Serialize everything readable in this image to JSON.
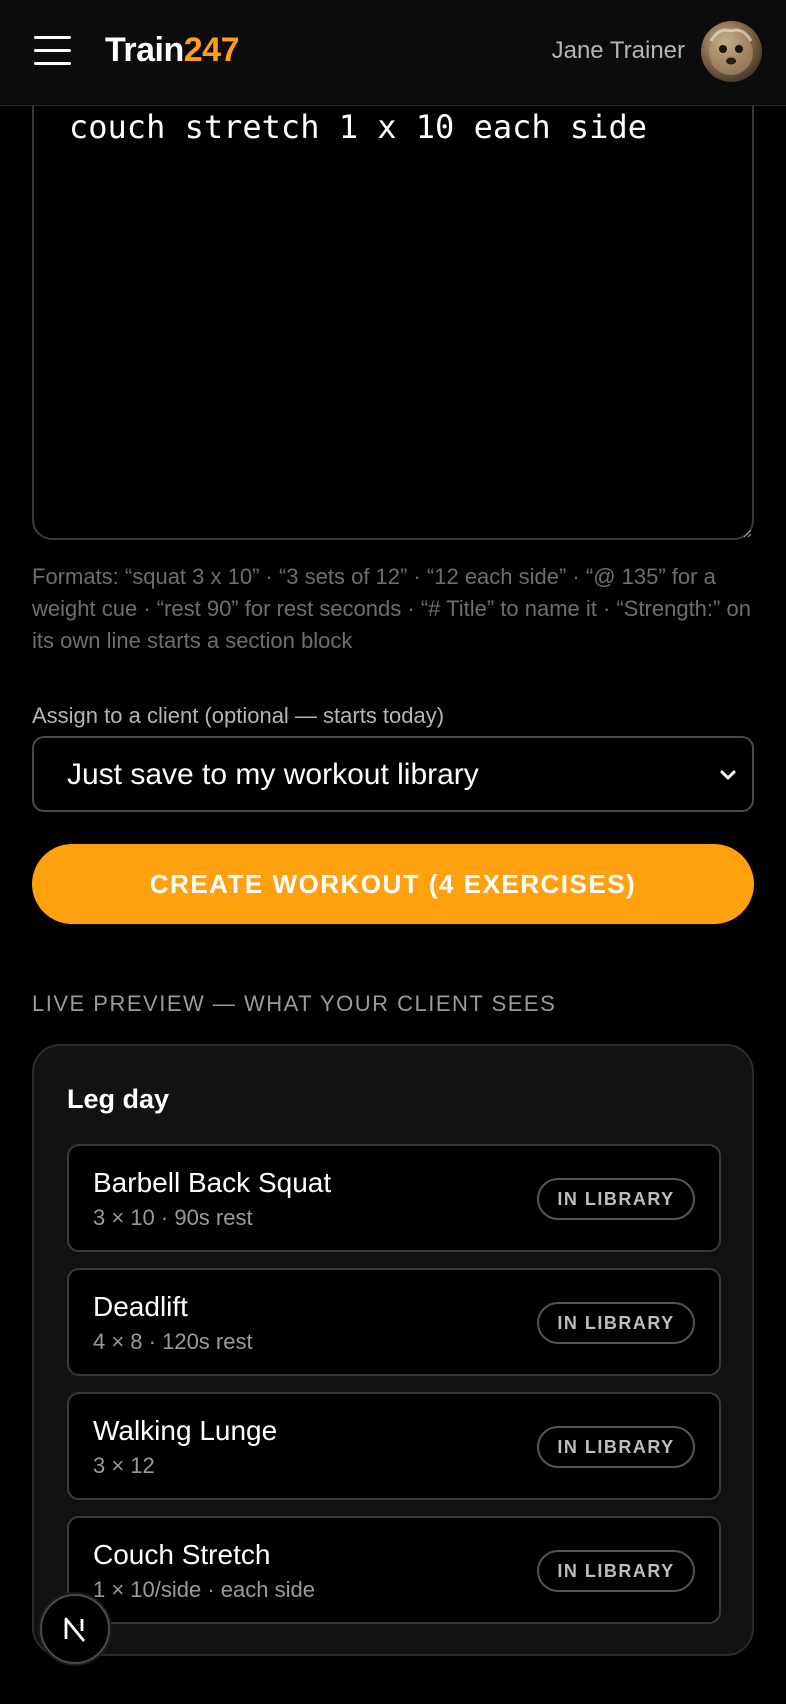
{
  "header": {
    "brand_main": "Train",
    "brand_accent": "247",
    "user_name": "Jane Trainer",
    "accent_color": "#ffa00f"
  },
  "editor": {
    "text": "couch stretch 1 x 10 each side",
    "help": "Formats: “squat 3 x 10” · “3 sets of 12” · “12 each side” · “@ 135” for a weight cue · “rest 90” for rest seconds · “# Title” to name it · “Strength:” on its own line starts a section block"
  },
  "assign": {
    "label": "Assign to a client (optional — starts today)",
    "selected": "Just save to my workout library"
  },
  "create_button": "CREATE WORKOUT (4 EXERCISES)",
  "preview": {
    "heading": "LIVE PREVIEW — WHAT YOUR CLIENT SEES",
    "title": "Leg day",
    "exercises": [
      {
        "name": "Barbell Back Squat",
        "meta": "3 × 10 · 90s rest",
        "badge": "IN LIBRARY"
      },
      {
        "name": "Deadlift",
        "meta": "4 × 8 · 120s rest",
        "badge": "IN LIBRARY"
      },
      {
        "name": "Walking Lunge",
        "meta": "3 × 12",
        "badge": "IN LIBRARY"
      },
      {
        "name": "Couch Stretch",
        "meta": "1 × 10/side · each side",
        "badge": "IN LIBRARY"
      }
    ]
  },
  "icons": {
    "menu": "hamburger-menu-icon",
    "select": "chevron-down-icon",
    "dev_badge": "next-logo-icon"
  }
}
